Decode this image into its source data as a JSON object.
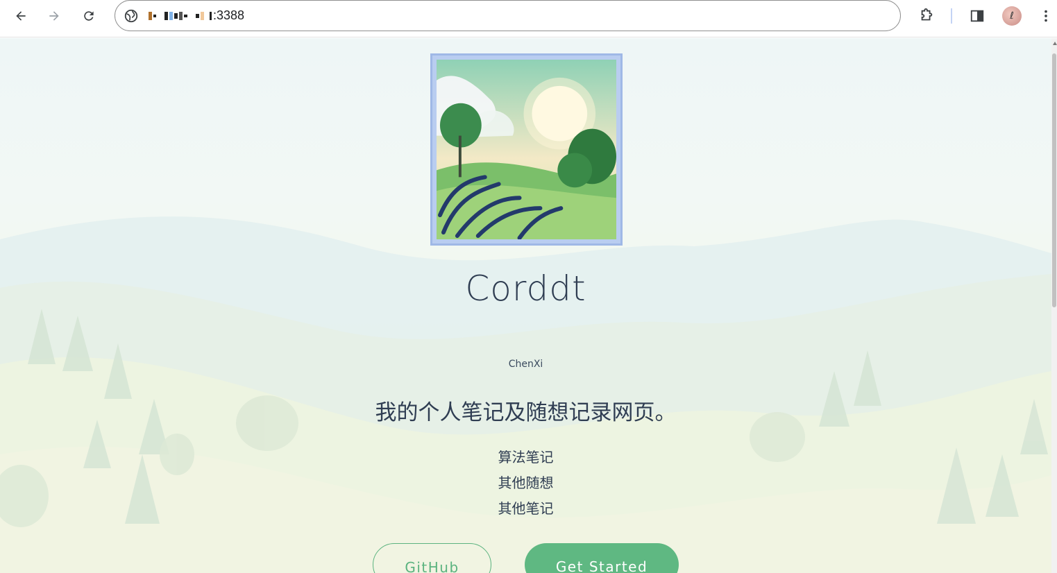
{
  "browser": {
    "url_visible": ":3388",
    "icons": [
      "back-arrow-icon",
      "forward-arrow-icon",
      "reload-icon",
      "site-info-icon",
      "extensions-icon",
      "side-panel-icon",
      "profile-avatar",
      "more-menu-icon"
    ]
  },
  "hero": {
    "title": "Corddt",
    "author": "ChenXi",
    "tagline": "我的个人笔记及随想记录网页。",
    "links": [
      "算法笔记",
      "其他随想",
      "其他笔记"
    ]
  },
  "actions": {
    "github_label": "GitHub",
    "start_label": "Get Started"
  },
  "colors": {
    "accent_green": "#5fb882",
    "text_dark": "#2f3d52",
    "image_border": "#9fb8e6"
  }
}
